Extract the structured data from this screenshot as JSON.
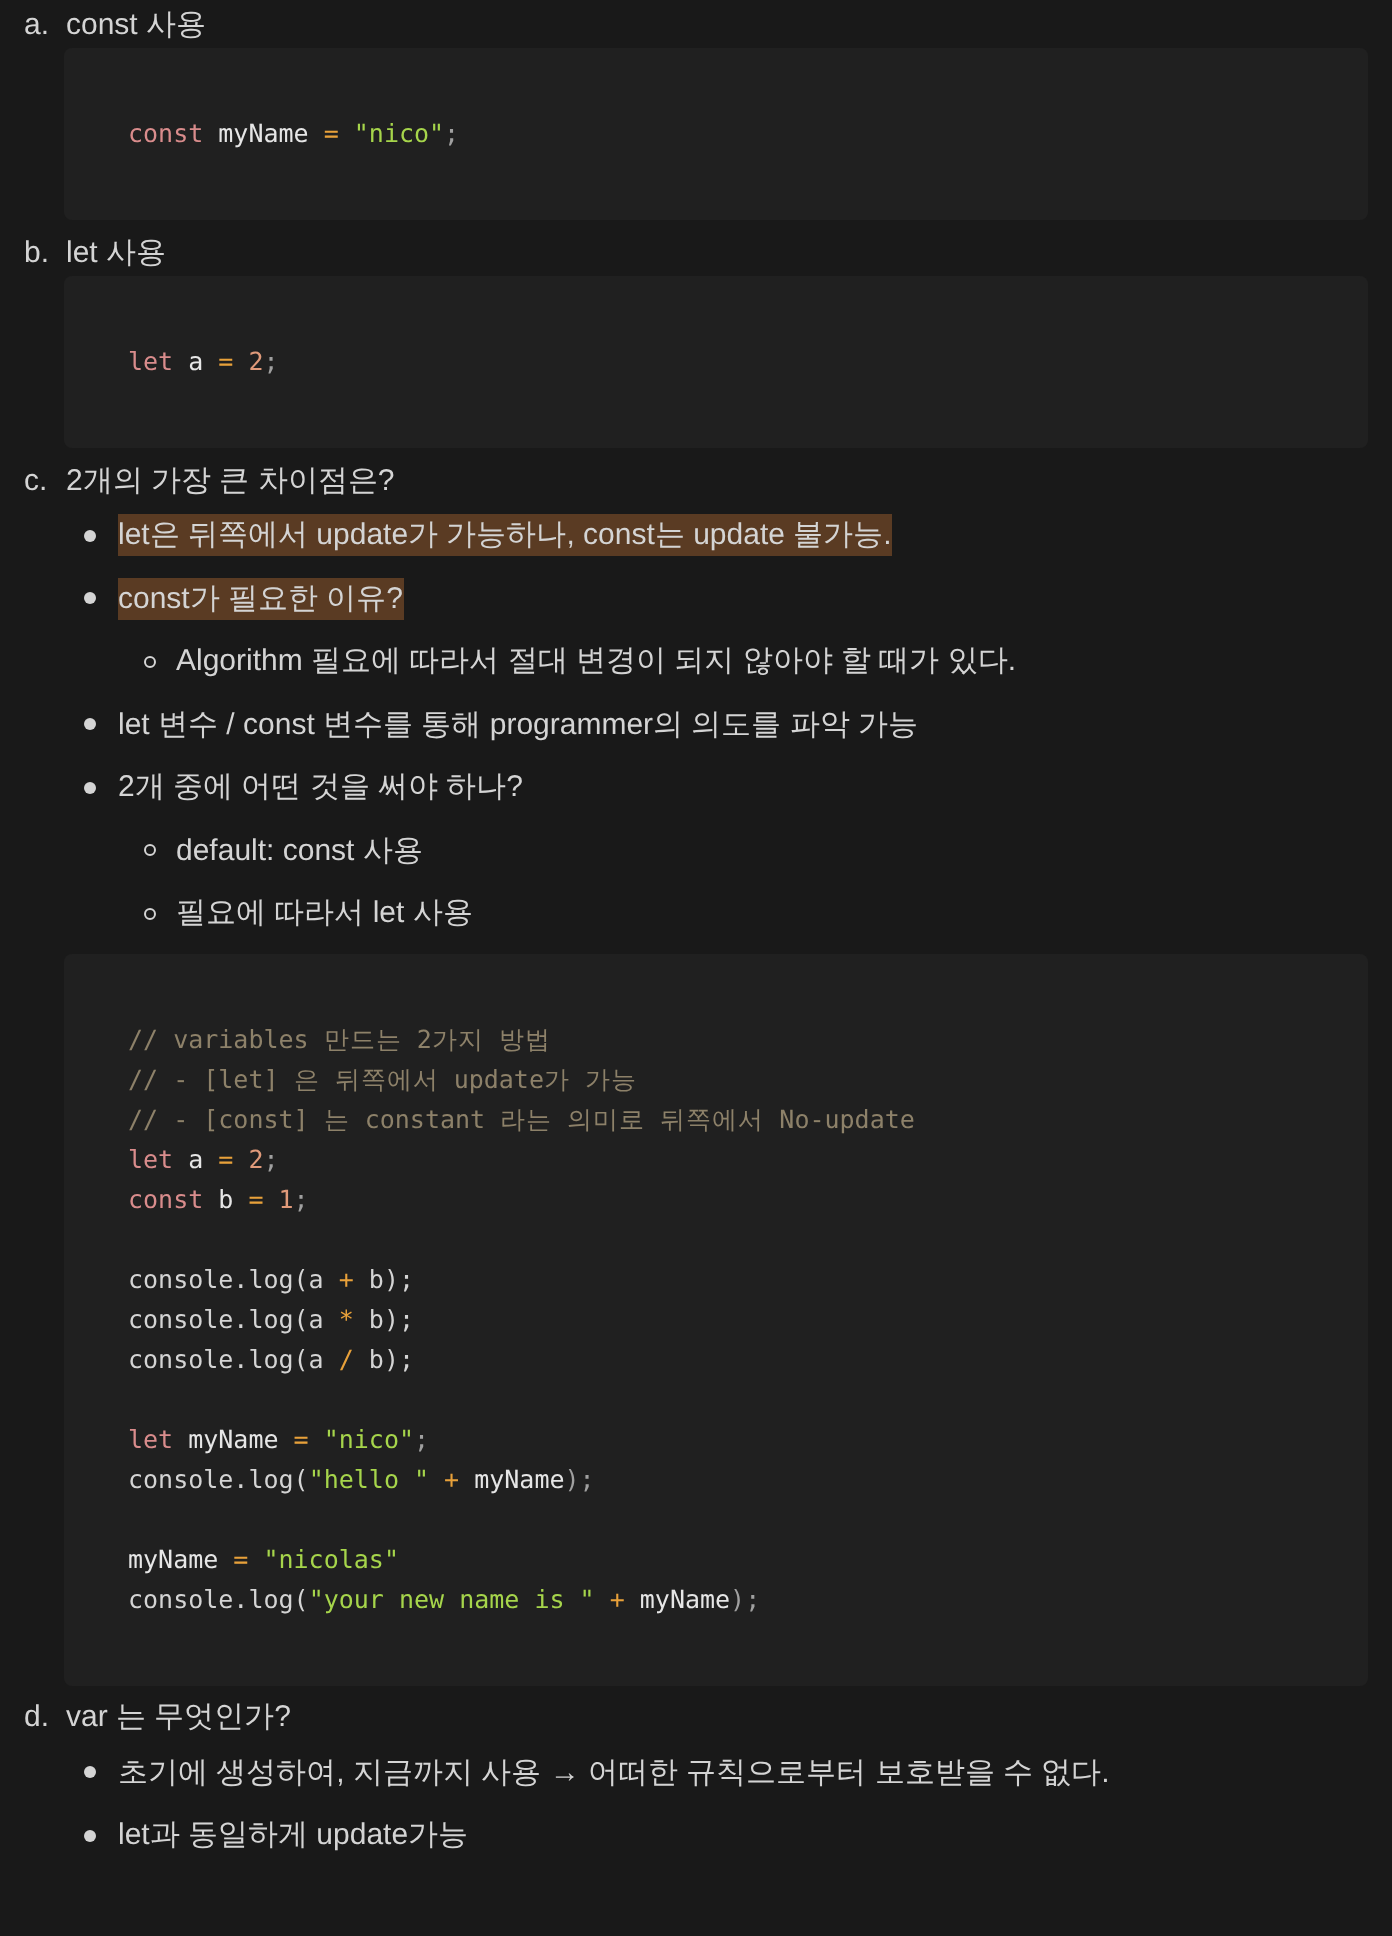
{
  "sections": [
    {
      "marker": "a.",
      "title": "const 사용",
      "content": [
        {
          "kind": "code",
          "lines": [
            {
              "kind": "tokens",
              "tokens": [
                {
                  "kind": "keyword",
                  "text": "const "
                },
                {
                  "kind": "ident",
                  "text": "myName"
                },
                {
                  "kind": "op",
                  "text": " = "
                },
                {
                  "kind": "string",
                  "text": "\"nico\""
                },
                {
                  "kind": "punct",
                  "text": ";"
                }
              ]
            }
          ]
        }
      ]
    },
    {
      "marker": "b.",
      "title": "let 사용",
      "content": [
        {
          "kind": "code",
          "lines": [
            {
              "kind": "tokens",
              "tokens": [
                {
                  "kind": "keyword",
                  "text": "let "
                },
                {
                  "kind": "ident",
                  "text": "a"
                },
                {
                  "kind": "op",
                  "text": " = "
                },
                {
                  "kind": "number",
                  "text": "2"
                },
                {
                  "kind": "punct",
                  "text": ";"
                }
              ]
            }
          ]
        }
      ]
    },
    {
      "marker": "c.",
      "title": "2개의 가장 큰 차이점은?",
      "content": [
        {
          "kind": "bullets",
          "items": [
            {
              "text": "let은 뒤쪽에서 update가 가능하나, const는 update 불가능.",
              "highlighted": true
            },
            {
              "text": "const가 필요한 이유?",
              "highlighted": true,
              "children": [
                {
                  "text": "Algorithm 필요에 따라서 절대 변경이 되지 않아야 할 때가 있다.",
                  "highlighted": false
                }
              ]
            },
            {
              "text": "let 변수 / const 변수를 통해 programmer의 의도를 파악 가능",
              "highlighted": false
            },
            {
              "text": "2개 중에 어떤 것을 써야 하나?",
              "highlighted": false,
              "children": [
                {
                  "text": "default: const 사용",
                  "highlighted": false
                },
                {
                  "text": "필요에 따라서 let 사용",
                  "highlighted": false
                }
              ]
            }
          ]
        },
        {
          "kind": "code",
          "lines": [
            {
              "kind": "tokens",
              "tokens": [
                {
                  "kind": "comment",
                  "text": "// variables 만드는 2가지 방법"
                }
              ]
            },
            {
              "kind": "tokens",
              "tokens": [
                {
                  "kind": "comment",
                  "text": "// - [let] 은 뒤쪽에서 update가 가능"
                }
              ]
            },
            {
              "kind": "tokens",
              "tokens": [
                {
                  "kind": "comment",
                  "text": "// - [const] 는 constant 라는 의미로 뒤쪽에서 No-update"
                }
              ]
            },
            {
              "kind": "tokens",
              "tokens": [
                {
                  "kind": "keyword",
                  "text": "let "
                },
                {
                  "kind": "ident",
                  "text": "a"
                },
                {
                  "kind": "op",
                  "text": " = "
                },
                {
                  "kind": "number",
                  "text": "2"
                },
                {
                  "kind": "punct",
                  "text": ";"
                }
              ]
            },
            {
              "kind": "tokens",
              "tokens": [
                {
                  "kind": "keyword",
                  "text": "const "
                },
                {
                  "kind": "ident",
                  "text": "b"
                },
                {
                  "kind": "op",
                  "text": " = "
                },
                {
                  "kind": "number",
                  "text": "1"
                },
                {
                  "kind": "punct",
                  "text": ";"
                }
              ]
            },
            {
              "kind": "blank"
            },
            {
              "kind": "tokens",
              "tokens": [
                {
                  "kind": "plain",
                  "text": "console.log(a"
                },
                {
                  "kind": "op",
                  "text": " + "
                },
                {
                  "kind": "plain",
                  "text": "b);"
                }
              ]
            },
            {
              "kind": "tokens",
              "tokens": [
                {
                  "kind": "plain",
                  "text": "console.log(a"
                },
                {
                  "kind": "op",
                  "text": " * "
                },
                {
                  "kind": "plain",
                  "text": "b);"
                }
              ]
            },
            {
              "kind": "tokens",
              "tokens": [
                {
                  "kind": "plain",
                  "text": "console.log(a"
                },
                {
                  "kind": "op",
                  "text": " / "
                },
                {
                  "kind": "plain",
                  "text": "b);"
                }
              ]
            },
            {
              "kind": "blank"
            },
            {
              "kind": "tokens",
              "tokens": [
                {
                  "kind": "keyword",
                  "text": "let "
                },
                {
                  "kind": "ident",
                  "text": "myName"
                },
                {
                  "kind": "op",
                  "text": " = "
                },
                {
                  "kind": "string",
                  "text": "\"nico\""
                },
                {
                  "kind": "punct",
                  "text": ";"
                }
              ]
            },
            {
              "kind": "tokens",
              "tokens": [
                {
                  "kind": "plain",
                  "text": "console.log("
                },
                {
                  "kind": "string",
                  "text": "\"hello \""
                },
                {
                  "kind": "op",
                  "text": " + "
                },
                {
                  "kind": "ident",
                  "text": "myName"
                },
                {
                  "kind": "punct",
                  "text": ");"
                }
              ]
            },
            {
              "kind": "blank"
            },
            {
              "kind": "tokens",
              "tokens": [
                {
                  "kind": "ident",
                  "text": "myName"
                },
                {
                  "kind": "op",
                  "text": " = "
                },
                {
                  "kind": "string",
                  "text": "\"nicolas\""
                }
              ]
            },
            {
              "kind": "tokens",
              "tokens": [
                {
                  "kind": "plain",
                  "text": "console.log("
                },
                {
                  "kind": "string",
                  "text": "\"your new name is \""
                },
                {
                  "kind": "op",
                  "text": " + "
                },
                {
                  "kind": "ident",
                  "text": "myName"
                },
                {
                  "kind": "punct",
                  "text": ");"
                }
              ]
            }
          ]
        }
      ]
    },
    {
      "marker": "d.",
      "title": "var 는 무엇인가?",
      "content": [
        {
          "kind": "bullets",
          "items": [
            {
              "text": "초기에 생성하여, 지금까지 사용 → 어떠한 규칙으로부터 보호받을 수 없다.",
              "highlighted": false
            },
            {
              "text": "let과 동일하게 update가능",
              "highlighted": false
            }
          ]
        }
      ]
    }
  ]
}
